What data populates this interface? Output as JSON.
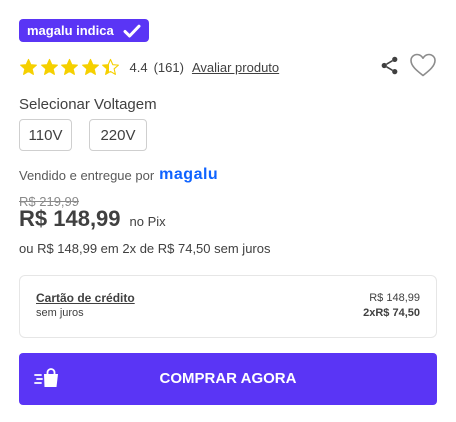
{
  "badge": {
    "label": "magalu indica",
    "icon": "check-icon"
  },
  "rating": {
    "stars": 4.4,
    "stars_max": 5,
    "value_text": "4.4",
    "count_text": "(161)",
    "review_link": "Avaliar produto",
    "star_color": "#f5d000"
  },
  "actions": {
    "share_icon": "share-icon",
    "favorite_icon": "heart-icon"
  },
  "voltage": {
    "title": "Selecionar Voltagem",
    "options": [
      "110V",
      "220V"
    ]
  },
  "seller": {
    "prefix": "Vendido e entregue por",
    "store_name": "magalu",
    "store_color": "#0f63ff"
  },
  "pricing": {
    "old_price": "R$ 219,99",
    "price": "R$ 148,99",
    "price_method": "no Pix",
    "installments_text": "ou R$ 148,99 em 2x de R$ 74,50 sem juros"
  },
  "payment_option": {
    "name": "Cartão de crédito",
    "subtitle": "sem juros",
    "price": "R$ 148,99",
    "installments": "2xR$ 74,50"
  },
  "buy_button": {
    "label": "COMPRAR AGORA",
    "icon": "cart-icon",
    "color": "#5a35f5"
  }
}
